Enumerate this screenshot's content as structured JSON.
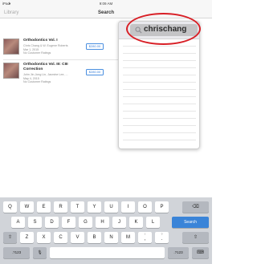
{
  "status_bar": {
    "carrier": "iPad",
    "wifi": "▾",
    "time": "9:09 AM"
  },
  "nav": {
    "left_label": "Library",
    "title": "Search"
  },
  "results": [
    {
      "title": "Orthodontics Vol. I",
      "author": "Chris Chang & W. Eugene Roberts",
      "date": "Mar 1, 2015",
      "ratings": "No Customer Ratings",
      "price": "$280.00"
    },
    {
      "title": "Orthodontics Vol. III: CIII Correction",
      "author": "John Jin-Jong Lin, Jasmine Lee, ...",
      "date": "May 4, 2015",
      "ratings": "No Customer Ratings",
      "price": "$280.00"
    }
  ],
  "search": {
    "query": "chrischang"
  },
  "keyboard": {
    "row1": [
      "Q",
      "W",
      "E",
      "R",
      "T",
      "Y",
      "U",
      "I",
      "O",
      "P"
    ],
    "row2": [
      "A",
      "S",
      "D",
      "F",
      "G",
      "H",
      "J",
      "K",
      "L"
    ],
    "row3": [
      "Z",
      "X",
      "C",
      "V",
      "B",
      "N",
      "M"
    ],
    "row3_punct": [
      {
        "sub": "!",
        "main": ","
      },
      {
        "sub": "?",
        "main": "."
      }
    ],
    "search_label": "Search",
    "numbers_label": ".?123",
    "backspace_glyph": "⌫",
    "shift_glyph": "⇧",
    "mic_glyph": "🎙",
    "hide_glyph": "⌨"
  },
  "colors": {
    "accent": "#3b82dc",
    "annotation": "#d81f26",
    "keyboard_bg": "#d1d4d9"
  }
}
